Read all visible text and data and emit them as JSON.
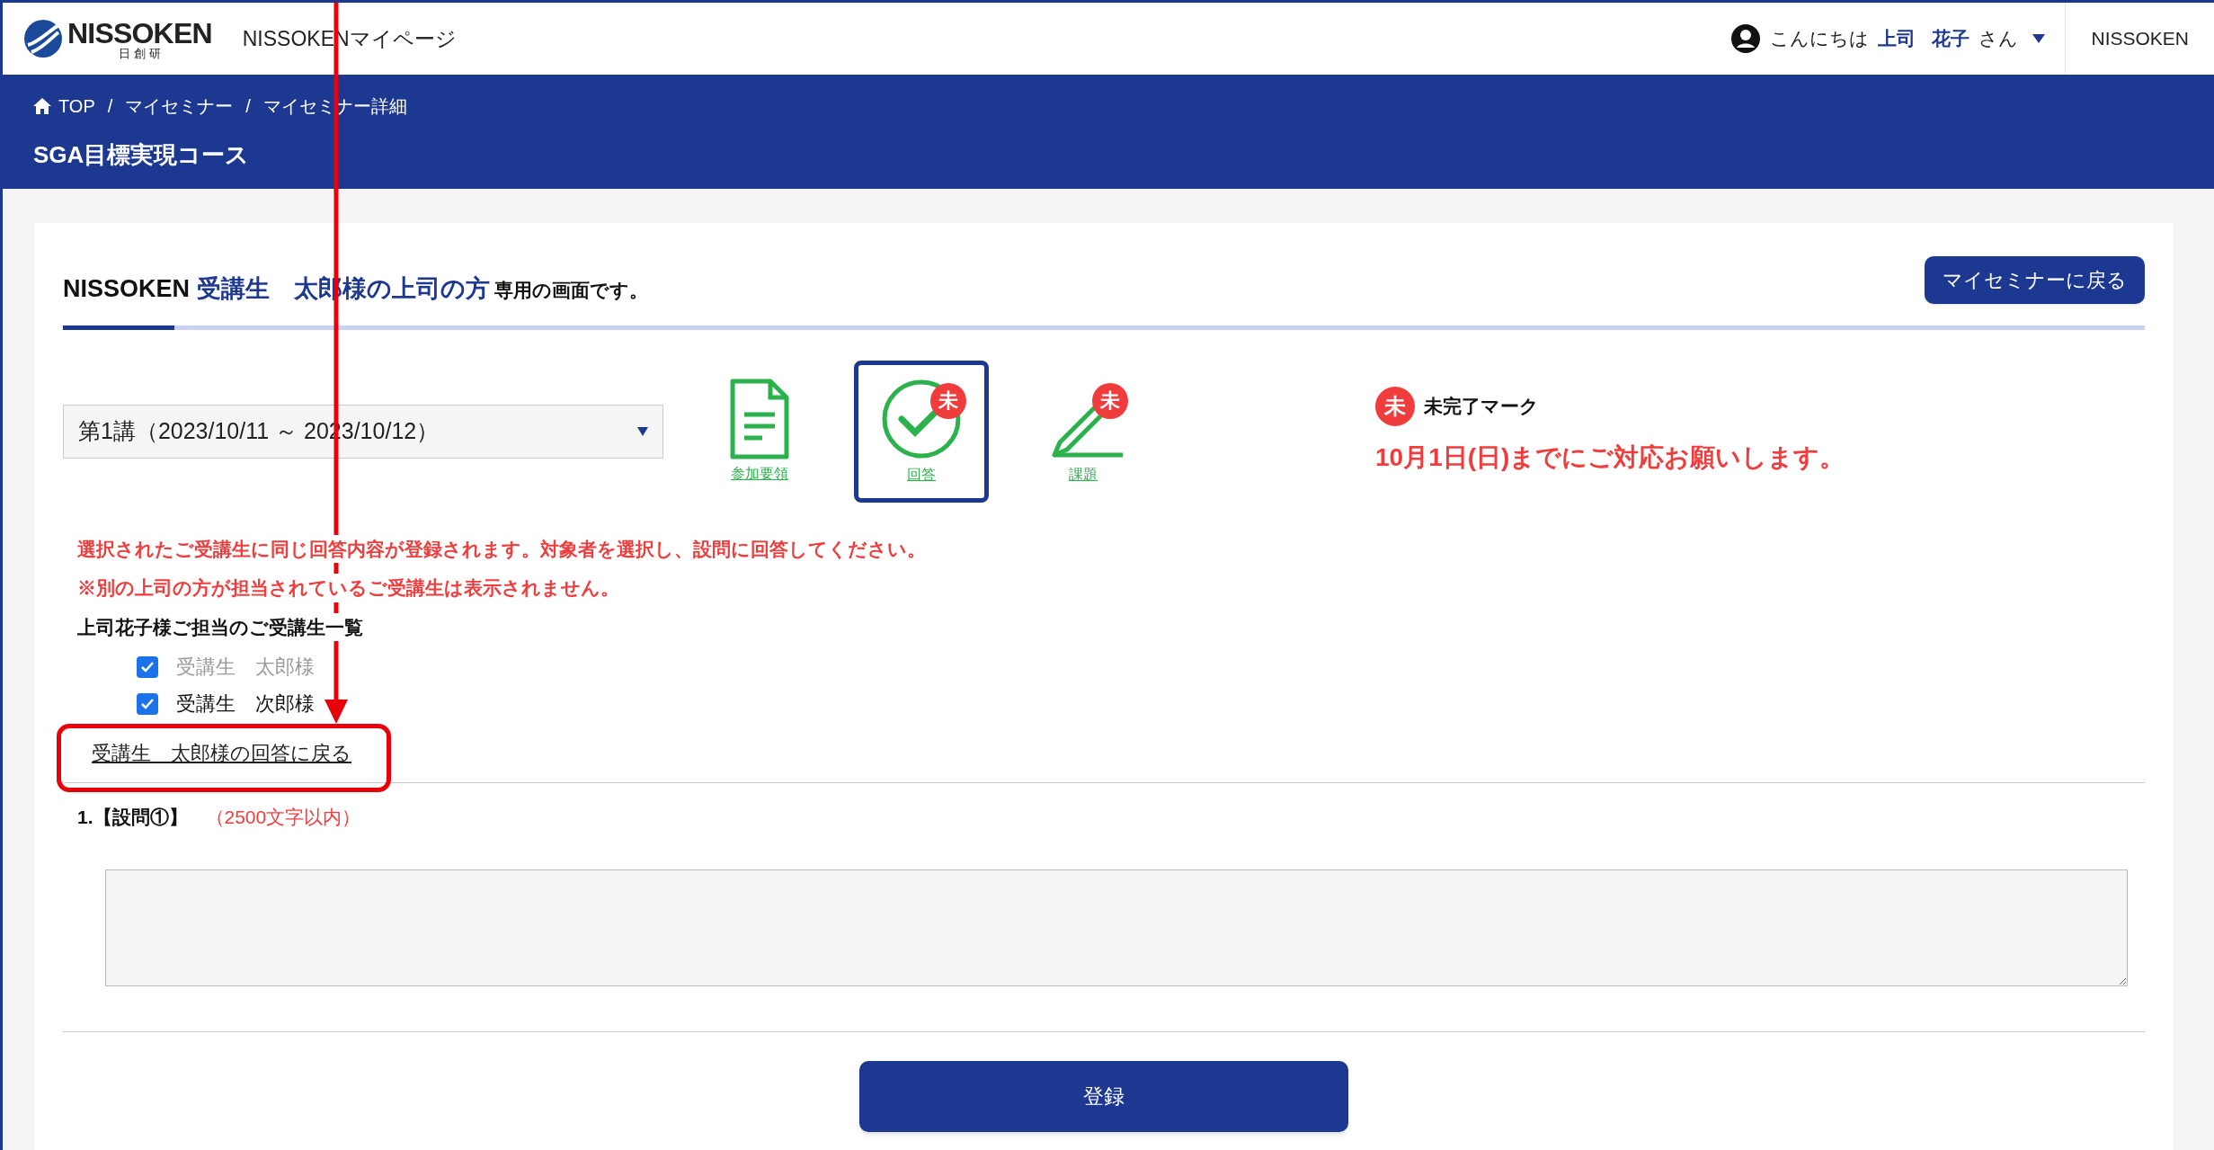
{
  "header": {
    "logo": {
      "wordmark": "NISSOKEN",
      "subtitle": "日 創 研"
    },
    "site_title": "NISSOKENマイページ",
    "greeting": {
      "prefix": "こんにちは",
      "last_name": "上司",
      "first_name": "花子",
      "suffix": "さん"
    },
    "company": "NISSOKEN"
  },
  "breadcrumb": {
    "separator": "/",
    "items": [
      "TOP",
      "マイセミナー",
      "マイセミナー詳細"
    ]
  },
  "page_title": "SGA目標実現コース",
  "intro": {
    "org": "NISSOKEN",
    "target": "受講生　太郎様の上司の方",
    "suffix": "専用の画面です。"
  },
  "back_button": "マイセミナーに戻る",
  "session_select": {
    "value": "第1講（2023/10/11 ～ 2023/10/12）"
  },
  "steps": [
    {
      "kind": "document",
      "label": "参加要領",
      "selected": false
    },
    {
      "kind": "check",
      "label": "回答",
      "selected": true,
      "badge": "未"
    },
    {
      "kind": "pencil",
      "label": "課題",
      "selected": false,
      "badge": "未"
    }
  ],
  "legend": {
    "badge": "未",
    "label": "未完了マーク",
    "deadline": "10月1日(日)までにご対応お願いします。"
  },
  "notices": [
    "選択されたご受講生に同じ回答内容が登録されます。対象者を選択し、設問に回答してください。",
    "※別の上司の方が担当されているご受講生は表示されません。"
  ],
  "student_list": {
    "title": "上司花子様ご担当のご受講生一覧",
    "items": [
      {
        "name": "受講生　太郎様",
        "checked": true,
        "disabled": true
      },
      {
        "name": "受講生　次郎様",
        "checked": true,
        "disabled": false
      }
    ]
  },
  "return_link": "受講生　太郎様の回答に戻る",
  "question": {
    "number": "1.【設問①】",
    "limit": "（2500文字以内）"
  },
  "submit_button": "登録"
}
